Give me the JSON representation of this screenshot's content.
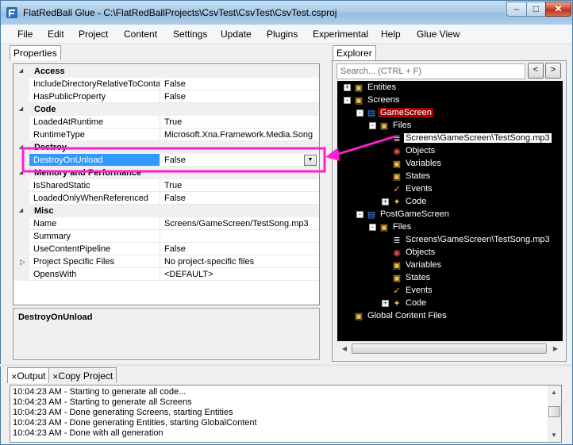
{
  "window": {
    "title": "FlatRedBall Glue - C:\\FlatRedBallProjects\\CsvTest\\CsvTest\\CsvTest.csproj",
    "min_glyph": "–",
    "max_glyph": "□",
    "close_glyph": "✕"
  },
  "menu": [
    "File",
    "Edit",
    "Project",
    "Content",
    "Settings",
    "Update",
    "Plugins",
    "Experimental",
    "Help",
    "Glue View"
  ],
  "properties_panel": {
    "tab_label": "Properties",
    "rows": [
      {
        "kind": "category",
        "name": "Access"
      },
      {
        "kind": "prop",
        "name": "IncludeDirectoryRelativeToContai",
        "value": "False"
      },
      {
        "kind": "prop",
        "name": "HasPublicProperty",
        "value": "False"
      },
      {
        "kind": "category",
        "name": "Code"
      },
      {
        "kind": "prop",
        "name": "LoadedAtRuntime",
        "value": "True"
      },
      {
        "kind": "prop",
        "name": "RuntimeType",
        "value": "Microsoft.Xna.Framework.Media.Song"
      },
      {
        "kind": "category",
        "name": "Destroy"
      },
      {
        "kind": "prop",
        "name": "DestroyOnUnload",
        "value": "False",
        "selected": true,
        "dropdown": true
      },
      {
        "kind": "category",
        "name": "Memory and Performance"
      },
      {
        "kind": "prop",
        "name": "IsSharedStatic",
        "value": "True"
      },
      {
        "kind": "prop",
        "name": "LoadedOnlyWhenReferenced",
        "value": "False"
      },
      {
        "kind": "category",
        "name": "Misc"
      },
      {
        "kind": "prop",
        "name": "Name",
        "value": "Screens/GameScreen/TestSong.mp3"
      },
      {
        "kind": "prop",
        "name": "Summary",
        "value": ""
      },
      {
        "kind": "prop",
        "name": "UseContentPipeline",
        "value": "False"
      },
      {
        "kind": "prop",
        "name": "Project Specific Files",
        "value": "No project-specific files",
        "expandable": true
      },
      {
        "kind": "prop",
        "name": "OpensWith",
        "value": "<DEFAULT>"
      }
    ],
    "description_title": "DestroyOnUnload"
  },
  "explorer": {
    "tab_label": "Explorer",
    "search_placeholder": "Search... (CTRL + F)",
    "back_label": "<",
    "forward_label": ">",
    "nodes": [
      {
        "label": "Entities",
        "icon": "folder-icon",
        "exp": "+"
      },
      {
        "label": "Screens",
        "icon": "folder-icon",
        "exp": "-"
      },
      {
        "label": "GameScreen",
        "icon": "screen-icon",
        "exp": "-",
        "highlight": "red"
      },
      {
        "label": "Files",
        "icon": "folder-icon",
        "exp": "-"
      },
      {
        "label": "Screens\\GameScreen\\TestSong.mp3",
        "icon": "file-icon",
        "exp": "",
        "highlight": "white"
      },
      {
        "label": "Objects",
        "icon": "objects-icon",
        "exp": ""
      },
      {
        "label": "Variables",
        "icon": "folder-icon",
        "exp": ""
      },
      {
        "label": "States",
        "icon": "folder-icon",
        "exp": ""
      },
      {
        "label": "Events",
        "icon": "events-icon",
        "exp": ""
      },
      {
        "label": "Code",
        "icon": "code-icon",
        "exp": "+"
      },
      {
        "label": "PostGameScreen",
        "icon": "screen-icon",
        "exp": "-"
      },
      {
        "label": "Files",
        "icon": "folder-icon",
        "exp": "-"
      },
      {
        "label": "Screens\\GameScreen\\TestSong.mp3",
        "icon": "file-icon",
        "exp": ""
      },
      {
        "label": "Objects",
        "icon": "objects-icon",
        "exp": ""
      },
      {
        "label": "Variables",
        "icon": "folder-icon",
        "exp": ""
      },
      {
        "label": "States",
        "icon": "folder-icon",
        "exp": ""
      },
      {
        "label": "Events",
        "icon": "events-icon",
        "exp": ""
      },
      {
        "label": "Code",
        "icon": "code-icon",
        "exp": "+"
      },
      {
        "label": "Global Content Files",
        "icon": "folder-icon",
        "exp": ""
      }
    ]
  },
  "bottom": {
    "tabs": [
      "Output",
      "Copy Project"
    ],
    "output_lines": [
      "10:04:23 AM - Starting to generate all code...",
      "10:04:23 AM - Starting to generate all Screens",
      "10:04:23 AM - Done generating Screens, starting Entities",
      "10:04:23 AM - Done generating Entities, starting GlobalContent",
      "10:04:23 AM - Done with all generation"
    ]
  },
  "colors": {
    "annotation": "#ff1fd2",
    "selection": "#3399ff",
    "tree_highlight": "#a00000",
    "tree_background": "#000000"
  }
}
